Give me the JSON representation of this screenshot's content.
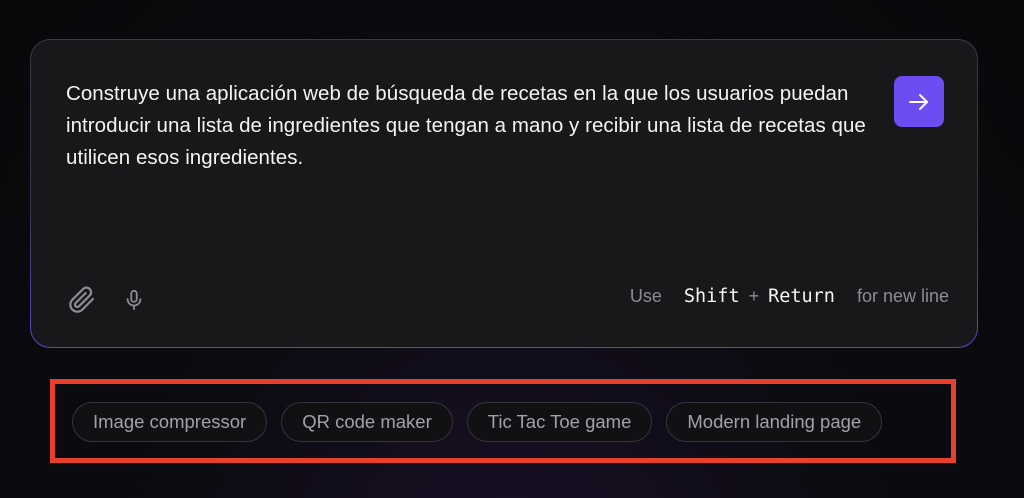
{
  "prompt": {
    "text": "Construye una aplicación web de búsqueda de recetas en la que los usuarios puedan introducir una lista de ingredientes que tengan a mano y recibir una lista de recetas que utilicen esos ingredientes."
  },
  "toolbar": {
    "attach_icon": "paperclip-icon",
    "mic_icon": "microphone-icon",
    "send_icon": "arrow-right-icon"
  },
  "hint": {
    "use": "Use",
    "key1": "Shift",
    "plus": "+",
    "key2": "Return",
    "suffix": "for new line"
  },
  "suggestions": [
    {
      "label": "Image compressor"
    },
    {
      "label": "QR code maker"
    },
    {
      "label": "Tic Tac Toe game"
    },
    {
      "label": "Modern landing page"
    }
  ],
  "colors": {
    "accent": "#6d4df2",
    "highlight": "#e8402a",
    "card_bg": "#18181b"
  }
}
